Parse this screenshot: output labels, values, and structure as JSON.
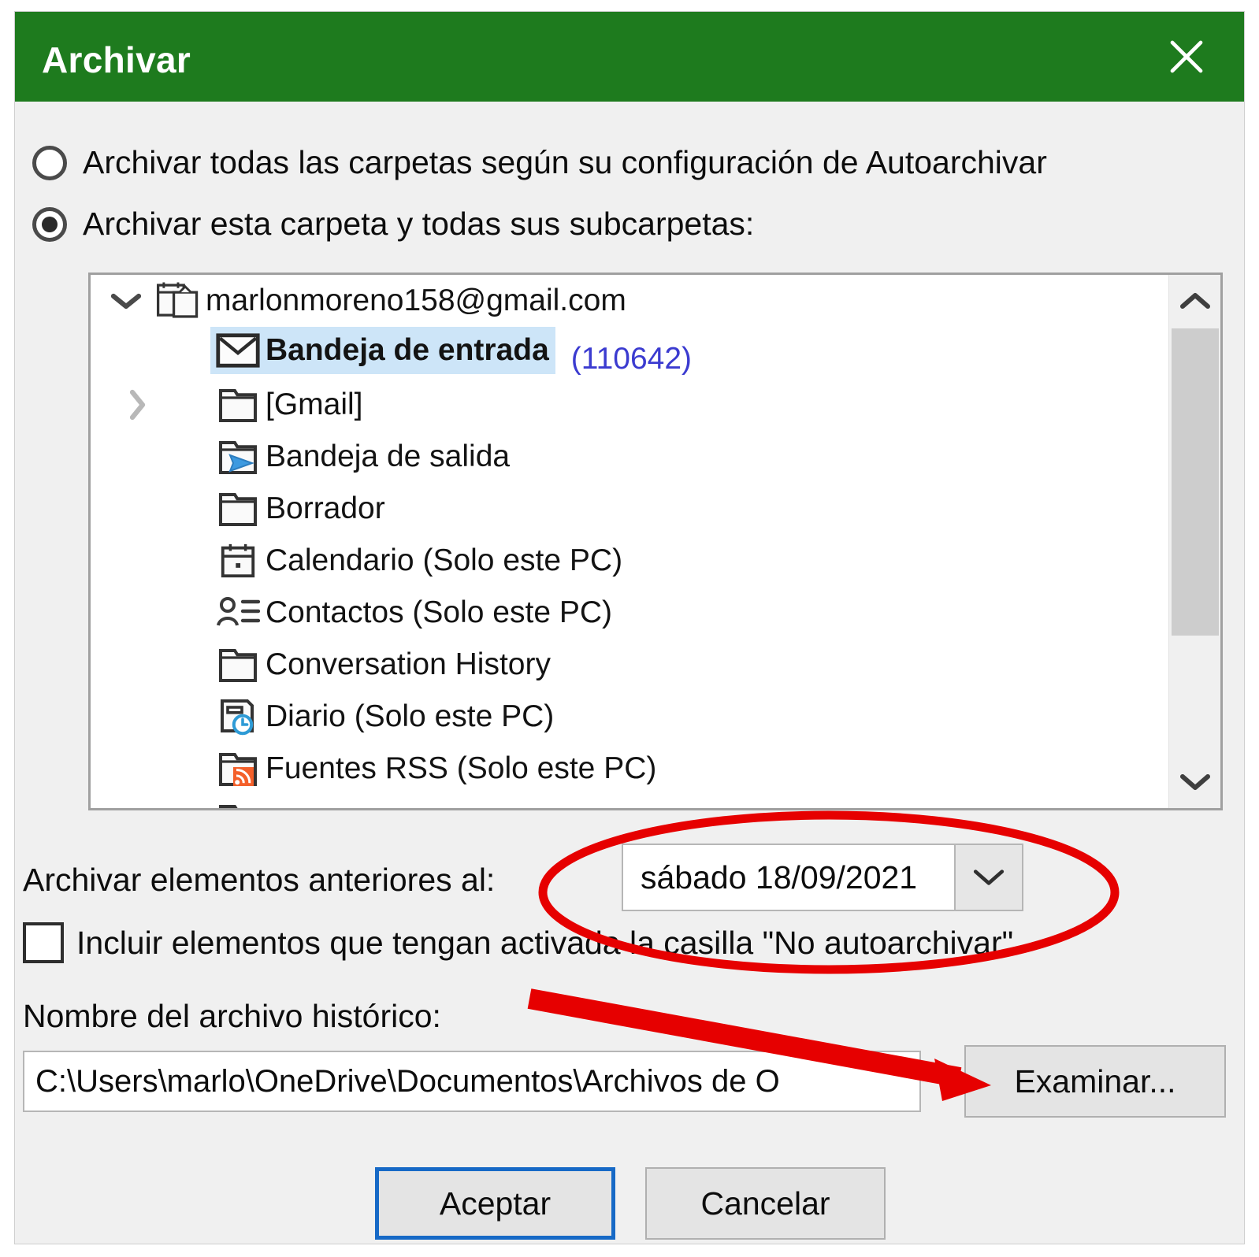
{
  "window": {
    "title": "Archivar",
    "titlebar_color": "#1e7b1e",
    "close_icon": "close-icon"
  },
  "options": {
    "archive_all_label": "Archivar todas las carpetas según su configuración de Autoarchivar",
    "archive_all_selected": false,
    "archive_folder_label": "Archivar esta carpeta y todas sus subcarpetas:",
    "archive_folder_selected": true
  },
  "tree": {
    "items": [
      {
        "label": "marlonmoreno158@gmail.com",
        "icon": "account-mailbox-icon",
        "chevron": "chevron-down-icon",
        "indent": 0,
        "selected": false,
        "count": ""
      },
      {
        "label": "Bandeja de entrada",
        "icon": "envelope-icon",
        "chevron": "",
        "indent": 1,
        "selected": true,
        "count": "(110642)"
      },
      {
        "label": "[Gmail]",
        "icon": "folder-icon",
        "chevron": "chevron-right-icon",
        "indent": 1,
        "selected": false,
        "count": ""
      },
      {
        "label": "Bandeja de salida",
        "icon": "outbox-icon",
        "chevron": "",
        "indent": 1,
        "selected": false,
        "count": ""
      },
      {
        "label": "Borrador",
        "icon": "folder-icon",
        "chevron": "",
        "indent": 1,
        "selected": false,
        "count": ""
      },
      {
        "label": "Calendario (Solo este PC)",
        "icon": "calendar-icon",
        "chevron": "",
        "indent": 1,
        "selected": false,
        "count": ""
      },
      {
        "label": "Contactos (Solo este PC)",
        "icon": "contacts-icon",
        "chevron": "",
        "indent": 1,
        "selected": false,
        "count": ""
      },
      {
        "label": "Conversation History",
        "icon": "folder-icon",
        "chevron": "",
        "indent": 1,
        "selected": false,
        "count": ""
      },
      {
        "label": "Diario (Solo este PC)",
        "icon": "journal-clock-icon",
        "chevron": "",
        "indent": 1,
        "selected": false,
        "count": ""
      },
      {
        "label": "Fuentes RSS (Solo este PC)",
        "icon": "rss-folder-icon",
        "chevron": "",
        "indent": 1,
        "selected": false,
        "count": ""
      }
    ],
    "scrollbar": {
      "up_icon": "chevron-up-icon",
      "down_icon": "chevron-down-icon"
    }
  },
  "date_row": {
    "label": "Archivar elementos anteriores al:",
    "value": "sábado 18/09/2021",
    "dropdown_icon": "chevron-down-icon"
  },
  "no_autoarchive": {
    "label": "Incluir elementos que tengan activada la casilla \"No autoarchivar\"",
    "checked": false
  },
  "archive_file": {
    "label": "Nombre del archivo histórico:",
    "value": "C:\\Users\\marlo\\OneDrive\\Documentos\\Archivos de O",
    "browse_label": "Examinar..."
  },
  "footer": {
    "ok_label": "Aceptar",
    "cancel_label": "Cancelar"
  },
  "annotations": {
    "highlight_color": "#e60000",
    "ellipse_target": "date-combo",
    "arrow_target": "browse-button"
  }
}
